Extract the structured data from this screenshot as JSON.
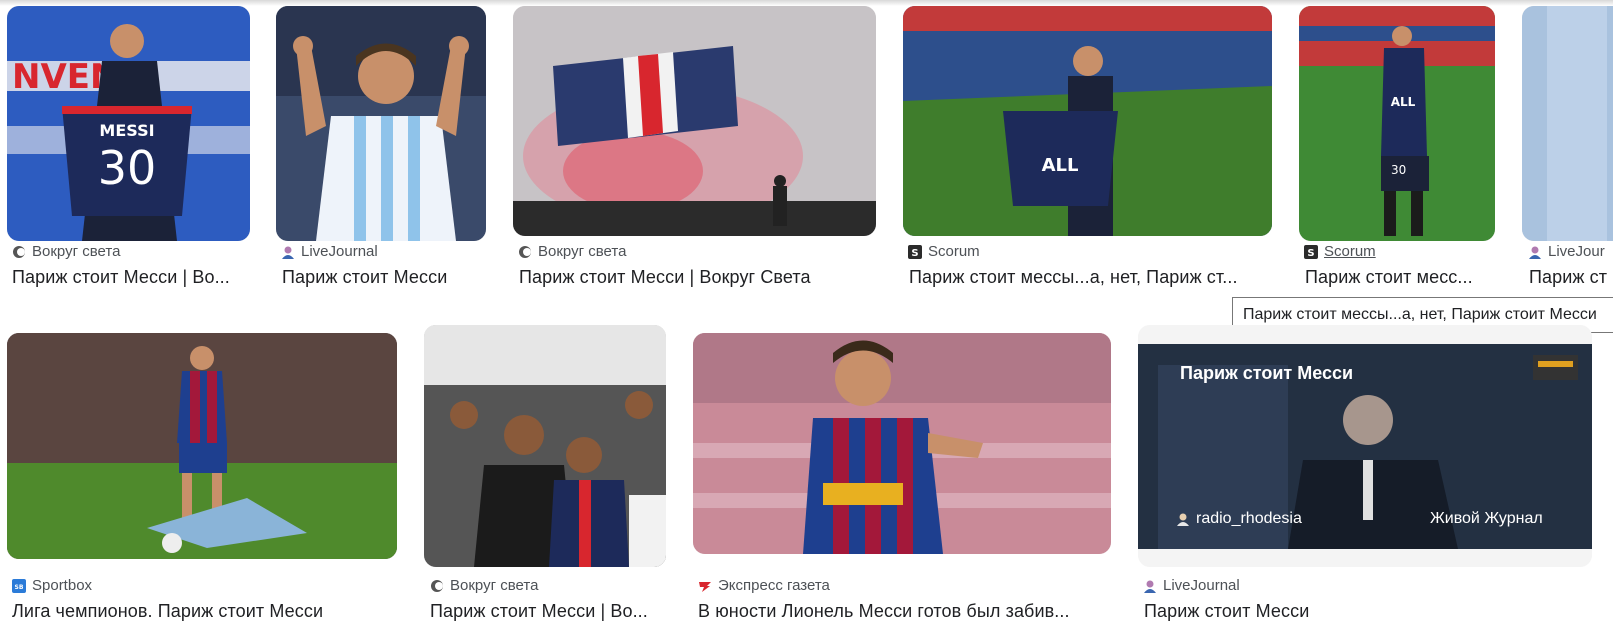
{
  "results": [
    {
      "source": "Вокруг света",
      "title": "Париж стоит Месси | Во...",
      "icon": "vokrug-sveta-icon"
    },
    {
      "source": "LiveJournal",
      "title": "Париж стоит Месси",
      "icon": "livejournal-icon"
    },
    {
      "source": "Вокруг света",
      "title": "Париж стоит Месси | Вокруг Света",
      "icon": "vokrug-sveta-icon"
    },
    {
      "source": "Scorum",
      "title": "Париж стоит мессы...а, нет, Париж ст...",
      "icon": "scorum-icon"
    },
    {
      "source": "Scorum",
      "title": "Париж стоит месс...",
      "icon": "scorum-icon"
    },
    {
      "source": "LiveJour",
      "title": "Париж ст",
      "icon": "livejournal-icon"
    },
    {
      "source": "Sportbox",
      "title": "Лига чемпионов. Париж стоит Месси",
      "icon": "sportbox-icon"
    },
    {
      "source": "Вокруг света",
      "title": "Париж стоит Месси | Во...",
      "icon": "vokrug-sveta-icon"
    },
    {
      "source": "Экспресс газета",
      "title": "В юности Лионель Месси готов был забив...",
      "icon": "express-gazeta-icon"
    },
    {
      "source": "LiveJournal",
      "title": "Париж стоит Месси",
      "icon": "livejournal-icon"
    }
  ],
  "tooltip": "Париж стоит мессы...а, нет, Париж стоит Месси",
  "images": {
    "jersey_text_messi": "MESSI",
    "jersey_number": "30",
    "jersey_number_small": "30",
    "sponsor": "ALL",
    "video_overlay": {
      "title": "Париж стоит Месси",
      "user": "radio_rhodesia",
      "channel": "Живой Журнал"
    }
  },
  "colors": {
    "psg_navy": "#1d2a5a",
    "psg_red": "#d8262e",
    "grass": "#3f7d2c",
    "barca_blue": "#1e3f8f",
    "barca_red": "#a3183a"
  }
}
